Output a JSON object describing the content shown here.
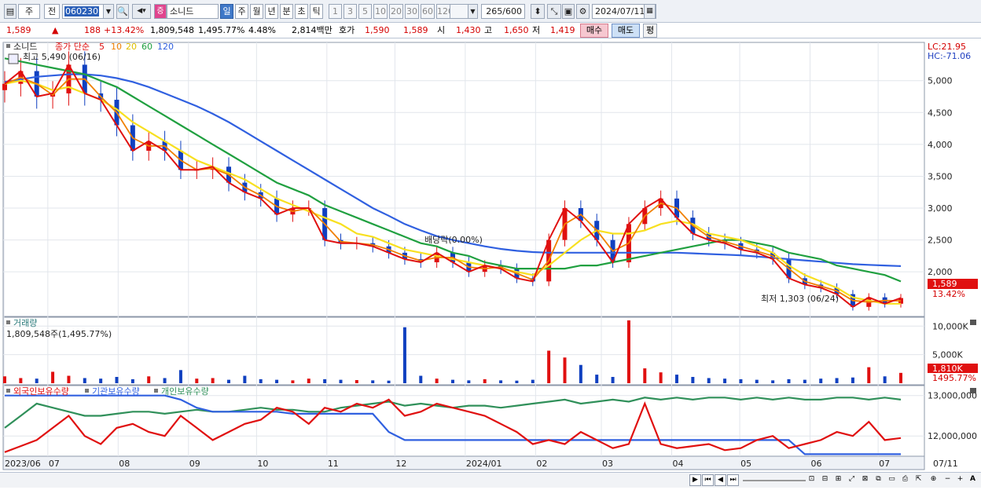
{
  "toolbar": {
    "period_type": "주",
    "prev_label": "전",
    "code": "060230",
    "stock_badge": "증",
    "stock_name": "소니드",
    "periods": [
      "일",
      "주",
      "월",
      "년",
      "분",
      "초",
      "틱"
    ],
    "selected_period": "일",
    "intervals": [
      "1",
      "3",
      "5",
      "10",
      "20",
      "30",
      "60",
      "120"
    ],
    "count": "265",
    "count_total": "/600",
    "date": "2024/07/11"
  },
  "quote": {
    "price": "1,589",
    "arrow": "▲",
    "change": "188",
    "change_pct": "+13.42%",
    "volume": "1,809,548",
    "volume_pct": "1,495.77%",
    "turnover": "4.48%",
    "amount": "2,814백만",
    "ask_label": "호가",
    "ask": "1,590",
    "bid": "1,589",
    "open_label": "시",
    "open": "1,430",
    "high_label": "고",
    "high": "1,650",
    "low_label": "저",
    "low": "1,419",
    "buy": "매수",
    "sell": "매도",
    "eval": "평"
  },
  "colors": {
    "ma5": "#e01010",
    "ma10": "#f08000",
    "ma20": "#f8e020",
    "ma60": "#20a040",
    "ma120": "#3060e0",
    "up": "#e01010",
    "down": "#1040c0",
    "foreign": "#e01010",
    "institution": "#3060e0",
    "individual": "#30905a"
  },
  "chart_data": [
    {
      "type": "line",
      "panel": "price",
      "title_name": "소니드",
      "legend_prefix": "종가 단순",
      "ma_periods": [
        "5",
        "10",
        "20",
        "60",
        "120"
      ],
      "max_label": "최고 5,490 (06/16)",
      "min_label": "최저 1,303 (06/24)",
      "annotation": "배당락(0.00%)",
      "lc_label": "LC:21.95",
      "hc_label": "HC:-71.06",
      "last_price": "1,589",
      "last_pct": "13.42%",
      "y_ticks": [
        "5,000",
        "4,500",
        "4,000",
        "3,500",
        "3,000",
        "2,500",
        "2,000"
      ],
      "y_tick_values": [
        5000,
        4500,
        4000,
        3500,
        3000,
        2500,
        2000
      ],
      "ylim": [
        1300,
        5600
      ],
      "x_ticks": [
        "2023/06",
        "07",
        "08",
        "09",
        "10",
        "11",
        "12",
        "2024/01",
        "02",
        "03",
        "04",
        "05",
        "06",
        "07",
        "07/11"
      ],
      "x": [
        "2023-06-12",
        "2023-06-16",
        "2023-06-23",
        "2023-06-30",
        "2023-07-07",
        "2023-07-14",
        "2023-07-21",
        "2023-07-28",
        "2023-08-04",
        "2023-08-11",
        "2023-08-18",
        "2023-08-25",
        "2023-09-01",
        "2023-09-08",
        "2023-09-15",
        "2023-09-22",
        "2023-10-06",
        "2023-10-13",
        "2023-10-20",
        "2023-10-27",
        "2023-11-03",
        "2023-11-10",
        "2023-11-17",
        "2023-11-24",
        "2023-12-01",
        "2023-12-08",
        "2023-12-15",
        "2023-12-22",
        "2023-12-29",
        "2024-01-05",
        "2024-01-12",
        "2024-01-19",
        "2024-01-26",
        "2024-02-02",
        "2024-02-08",
        "2024-02-16",
        "2024-02-23",
        "2024-03-01",
        "2024-03-08",
        "2024-03-15",
        "2024-03-22",
        "2024-03-29",
        "2024-04-05",
        "2024-04-12",
        "2024-04-19",
        "2024-04-26",
        "2024-05-03",
        "2024-05-10",
        "2024-05-17",
        "2024-05-24",
        "2024-05-31",
        "2024-06-07",
        "2024-06-14",
        "2024-06-21",
        "2024-06-28",
        "2024-07-05",
        "2024-07-11"
      ],
      "close": [
        4950,
        5150,
        4750,
        4800,
        5250,
        4800,
        4700,
        4300,
        3900,
        4050,
        3900,
        3600,
        3600,
        3650,
        3400,
        3250,
        3150,
        2900,
        3000,
        3000,
        2500,
        2450,
        2450,
        2400,
        2300,
        2200,
        2150,
        2300,
        2150,
        2000,
        2100,
        2050,
        1900,
        1850,
        2500,
        3000,
        2800,
        2500,
        2150,
        2750,
        3000,
        3150,
        2850,
        2600,
        2500,
        2450,
        2350,
        2300,
        2200,
        1900,
        1800,
        1750,
        1650,
        1450,
        1600,
        1500,
        1589
      ],
      "ma20": [
        4950,
        5000,
        4950,
        4850,
        4900,
        4800,
        4700,
        4550,
        4350,
        4200,
        4050,
        3900,
        3750,
        3650,
        3550,
        3450,
        3300,
        3150,
        3050,
        2950,
        2850,
        2750,
        2600,
        2550,
        2450,
        2350,
        2300,
        2250,
        2200,
        2150,
        2100,
        2050,
        2000,
        1950,
        2100,
        2300,
        2500,
        2650,
        2600,
        2600,
        2650,
        2750,
        2800,
        2750,
        2600,
        2550,
        2500,
        2400,
        2300,
        2100,
        1950,
        1850,
        1750,
        1600,
        1550,
        1500,
        1500
      ],
      "ma60": [
        5350,
        5300,
        5250,
        5200,
        5150,
        5100,
        5000,
        4900,
        4750,
        4600,
        4450,
        4300,
        4150,
        4000,
        3850,
        3700,
        3550,
        3400,
        3300,
        3200,
        3050,
        2950,
        2850,
        2750,
        2650,
        2550,
        2450,
        2400,
        2300,
        2250,
        2150,
        2100,
        2050,
        2050,
        2050,
        2050,
        2100,
        2100,
        2150,
        2200,
        2250,
        2300,
        2350,
        2400,
        2450,
        2500,
        2500,
        2450,
        2400,
        2300,
        2250,
        2200,
        2100,
        2050,
        2000,
        1950,
        1850
      ],
      "ma120": [
        4980,
        5020,
        5060,
        5080,
        5100,
        5100,
        5080,
        5040,
        4980,
        4900,
        4800,
        4700,
        4600,
        4480,
        4350,
        4200,
        4050,
        3900,
        3750,
        3600,
        3450,
        3300,
        3150,
        3000,
        2880,
        2750,
        2650,
        2560,
        2500,
        2450,
        2400,
        2360,
        2330,
        2310,
        2300,
        2300,
        2300,
        2300,
        2300,
        2300,
        2300,
        2300,
        2300,
        2290,
        2280,
        2270,
        2260,
        2240,
        2220,
        2200,
        2180,
        2160,
        2140,
        2120,
        2110,
        2100,
        2090
      ]
    },
    {
      "type": "bar",
      "panel": "volume",
      "title": "거래량",
      "current_label": "1,809,548주(1,495.77%)",
      "y_ticks": [
        "10,000K",
        "5,000K"
      ],
      "y_tick_values": [
        10000,
        5000
      ],
      "ylim": [
        0,
        11000
      ],
      "last_volume": "1,810K",
      "last_pct": "1495.77%",
      "values_k": [
        1200,
        900,
        800,
        2000,
        1300,
        900,
        800,
        1100,
        700,
        1200,
        900,
        2300,
        800,
        900,
        600,
        1300,
        700,
        600,
        500,
        800,
        700,
        600,
        550,
        500,
        450,
        9800,
        1300,
        800,
        600,
        500,
        700,
        500,
        450,
        600,
        5700,
        4500,
        3200,
        1500,
        1100,
        11000,
        2600,
        1900,
        1500,
        1100,
        900,
        800,
        700,
        600,
        500,
        700,
        600,
        800,
        900,
        1000,
        2800,
        1200,
        1810
      ]
    },
    {
      "type": "line",
      "panel": "holdings",
      "legend": [
        "외국인보유수량",
        "기관보유수량",
        "개인보유수량"
      ],
      "y_ticks": [
        "13,000,000",
        "12,000,000"
      ],
      "y_tick_values": [
        13000000,
        12000000
      ],
      "ylim": [
        11500000,
        13150000
      ],
      "foreign": [
        11600000,
        11750000,
        11900000,
        12200000,
        12500000,
        12000000,
        11800000,
        12200000,
        12300000,
        12100000,
        12000000,
        12500000,
        12200000,
        11900000,
        12100000,
        12300000,
        12400000,
        12700000,
        12600000,
        12300000,
        12700000,
        12600000,
        12800000,
        12700000,
        12900000,
        12500000,
        12600000,
        12800000,
        12700000,
        12600000,
        12500000,
        12300000,
        12100000,
        11800000,
        11900000,
        11800000,
        12100000,
        11900000,
        11700000,
        11800000,
        12800000,
        11800000,
        11700000,
        11750000,
        11800000,
        11650000,
        11700000,
        11900000,
        12000000,
        11700000,
        11800000,
        11900000,
        12100000,
        12000000,
        12350000,
        11900000,
        11950000
      ],
      "institution": [
        13000000,
        13000000,
        13000000,
        13000000,
        13000000,
        13000000,
        13000000,
        13000000,
        13000000,
        13000000,
        13000000,
        12900000,
        12700000,
        12600000,
        12600000,
        12600000,
        12600000,
        12600000,
        12550000,
        12550000,
        12550000,
        12550000,
        12550000,
        12550000,
        12100000,
        11900000,
        11900000,
        11900000,
        11900000,
        11900000,
        11900000,
        11900000,
        11900000,
        11900000,
        11900000,
        11900000,
        11900000,
        11900000,
        11900000,
        11900000,
        11900000,
        11900000,
        11900000,
        11900000,
        11900000,
        11900000,
        11900000,
        11900000,
        11900000,
        11900000,
        11550000,
        11550000,
        11550000,
        11550000,
        11550000,
        11550000,
        11550000
      ],
      "individual": [
        12200000,
        12500000,
        12800000,
        12700000,
        12600000,
        12500000,
        12500000,
        12550000,
        12600000,
        12600000,
        12550000,
        12600000,
        12650000,
        12600000,
        12600000,
        12650000,
        12700000,
        12650000,
        12650000,
        12600000,
        12600000,
        12700000,
        12750000,
        12800000,
        12850000,
        12750000,
        12800000,
        12750000,
        12700000,
        12750000,
        12750000,
        12700000,
        12750000,
        12800000,
        12850000,
        12900000,
        12800000,
        12850000,
        12900000,
        12850000,
        12950000,
        12900000,
        12950000,
        12900000,
        12950000,
        12950000,
        12900000,
        12950000,
        12900000,
        12950000,
        12900000,
        12900000,
        12950000,
        12950000,
        12900000,
        12950000,
        12900000
      ]
    }
  ]
}
